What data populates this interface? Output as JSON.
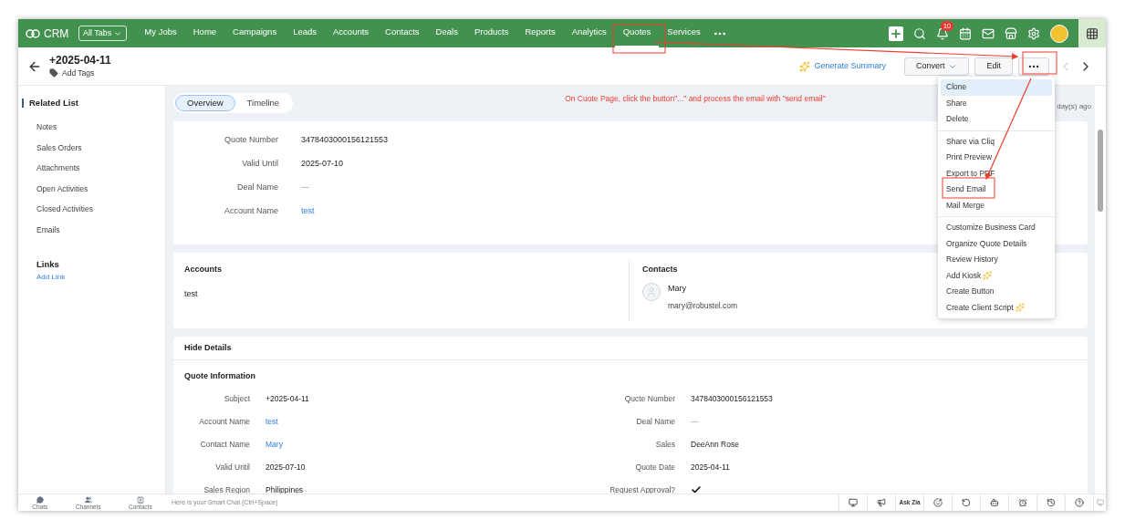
{
  "app": {
    "name": "CRM",
    "all_tabs": "All Tabs"
  },
  "nav_tabs": [
    {
      "label": "My Jobs",
      "selected": false
    },
    {
      "label": "Home",
      "selected": false
    },
    {
      "label": "Campaigns",
      "selected": false
    },
    {
      "label": "Leads",
      "selected": false
    },
    {
      "label": "Accounts",
      "selected": false
    },
    {
      "label": "Contacts",
      "selected": false
    },
    {
      "label": "Deals",
      "selected": false
    },
    {
      "label": "Products",
      "selected": false
    },
    {
      "label": "Reports",
      "selected": false
    },
    {
      "label": "Analytics",
      "selected": false
    },
    {
      "label": "Quotes",
      "selected": true
    },
    {
      "label": "Services",
      "selected": false
    }
  ],
  "notification_count": "10",
  "record": {
    "title": "+2025-04-11",
    "add_tags": "Add Tags",
    "generate_summary": "Generate Summary",
    "convert": "Convert",
    "edit": "Edit"
  },
  "sidebar": {
    "title": "Related List",
    "items": [
      "Notes",
      "Sales Orders",
      "Attachments",
      "Open Activities",
      "Closed Activities",
      "Emails"
    ],
    "links_title": "Links",
    "add_link": "Add Link"
  },
  "view_tabs": [
    {
      "label": "Overview",
      "selected": true
    },
    {
      "label": "Timeline",
      "selected": false
    }
  ],
  "annotation": "On Cuote Page, click the button\"...\" and process the email with \"send email\"",
  "last_modified": "day(s) ago",
  "overview_fields": [
    {
      "label": "Quote Number",
      "value": "3478403000156121553",
      "kind": "text"
    },
    {
      "label": "Valid Until",
      "value": "2025-07-10",
      "kind": "text"
    },
    {
      "label": "Deal Name",
      "value": "—",
      "kind": "empty"
    },
    {
      "label": "Account Name",
      "value": "test",
      "kind": "link"
    }
  ],
  "accounts": {
    "title": "Accounts",
    "name": "test"
  },
  "contacts": {
    "title": "Contacts",
    "name": "Mary",
    "email": "mary@robustel.com"
  },
  "details": {
    "toggle": "Hide Details",
    "section": "Quote Information",
    "left": [
      {
        "label": "Subject",
        "value": "+2025-04-11",
        "kind": "text"
      },
      {
        "label": "Account Name",
        "value": "test",
        "kind": "link"
      },
      {
        "label": "Contact Name",
        "value": "Mary",
        "kind": "link"
      },
      {
        "label": "Valid Until",
        "value": "2025-07-10",
        "kind": "text"
      },
      {
        "label": "Sales Region",
        "value": "Philippines",
        "kind": "text"
      }
    ],
    "right": [
      {
        "label": "Qucte Number",
        "value": "3478403000156121553",
        "kind": "text"
      },
      {
        "label": "Deal Name",
        "value": "—",
        "kind": "empty"
      },
      {
        "label": "Sales",
        "value": "DeeAnn Rose",
        "kind": "text"
      },
      {
        "label": "Quote Date",
        "value": "2025-04-11",
        "kind": "text"
      },
      {
        "label": "Request Approval?",
        "kind": "check"
      }
    ]
  },
  "menu": [
    [
      {
        "label": "Clone",
        "selected": true,
        "sparkle": false
      },
      {
        "label": "Share",
        "selected": false,
        "sparkle": false
      },
      {
        "label": "Delete",
        "selected": false,
        "sparkle": false
      }
    ],
    [
      {
        "label": "Share via Cliq",
        "selected": false,
        "sparkle": false
      },
      {
        "label": "Print Preview",
        "selected": false,
        "sparkle": false
      },
      {
        "label": "Export to PDF",
        "selected": false,
        "sparkle": false
      },
      {
        "label": "Send Email",
        "selected": false,
        "sparkle": false
      },
      {
        "label": "Mail Merge",
        "selected": false,
        "sparkle": false
      }
    ],
    [
      {
        "label": "Customize Business Card",
        "selected": false,
        "sparkle": false
      },
      {
        "label": "Organize Quote Details",
        "selected": false,
        "sparkle": false
      },
      {
        "label": "Review History",
        "selected": false,
        "sparkle": false
      },
      {
        "label": "Add Kiosk",
        "selected": false,
        "sparkle": true
      },
      {
        "label": "Create Button",
        "selected": false,
        "sparkle": false
      },
      {
        "label": "Create Client Script",
        "selected": false,
        "sparkle": true
      }
    ]
  ],
  "bottom_bar": {
    "apps": [
      "Chats",
      "Channels",
      "Contacts"
    ],
    "smart_chat": "Here is your Smart Chat (Ctrl+Space)",
    "ask_zia": "Ask Zia"
  }
}
